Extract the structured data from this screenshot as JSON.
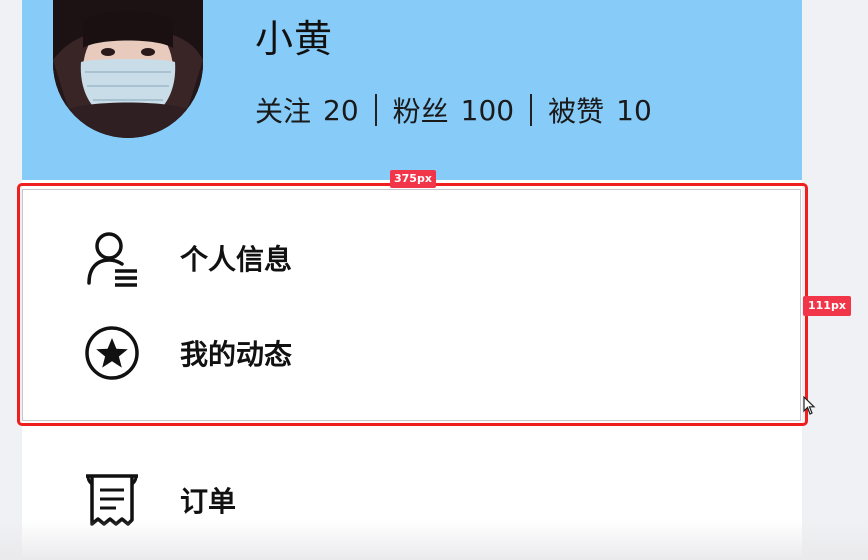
{
  "profile": {
    "username": "小黄",
    "stats": [
      {
        "label": "关注",
        "value": "20"
      },
      {
        "label": "粉丝",
        "value": "100"
      },
      {
        "label": "被赞",
        "value": "10"
      }
    ]
  },
  "menu": {
    "items": [
      {
        "label": "个人信息",
        "icon": "user-info-icon"
      },
      {
        "label": "我的动态",
        "icon": "star-circle-icon"
      },
      {
        "label": "订单",
        "icon": "receipt-icon"
      }
    ]
  },
  "measure": {
    "width_tag": "375px",
    "height_tag": "111px"
  },
  "colors": {
    "header_bg": "#87cbf8",
    "highlight": "#f01f1f"
  }
}
